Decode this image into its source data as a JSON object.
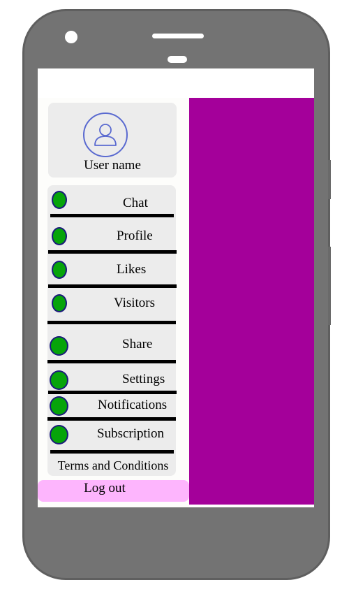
{
  "colors": {
    "phone_body": "#737373",
    "content_panel": "#a4009a",
    "card_background": "#ececec",
    "menu_dot": "#06a40a",
    "logout_background": "#fdb5fd",
    "avatar_stroke": "#5a6ad0"
  },
  "profile": {
    "avatar_icon": "user-icon",
    "user_name": "User name"
  },
  "menu": {
    "items": [
      {
        "label": "Chat",
        "icon": "menu-dot-icon"
      },
      {
        "label": "Profile",
        "icon": "menu-dot-icon"
      },
      {
        "label": "Likes",
        "icon": "menu-dot-icon"
      },
      {
        "label": "Visitors",
        "icon": "menu-dot-icon"
      },
      {
        "label": "Share",
        "icon": "menu-dot-icon"
      },
      {
        "label": "Settings",
        "icon": "menu-dot-icon"
      },
      {
        "label": "Notifications",
        "icon": "menu-dot-icon"
      },
      {
        "label": "Subscription",
        "icon": "menu-dot-icon"
      }
    ],
    "terms_label": "Terms and Conditions"
  },
  "logout_label": "Log out"
}
